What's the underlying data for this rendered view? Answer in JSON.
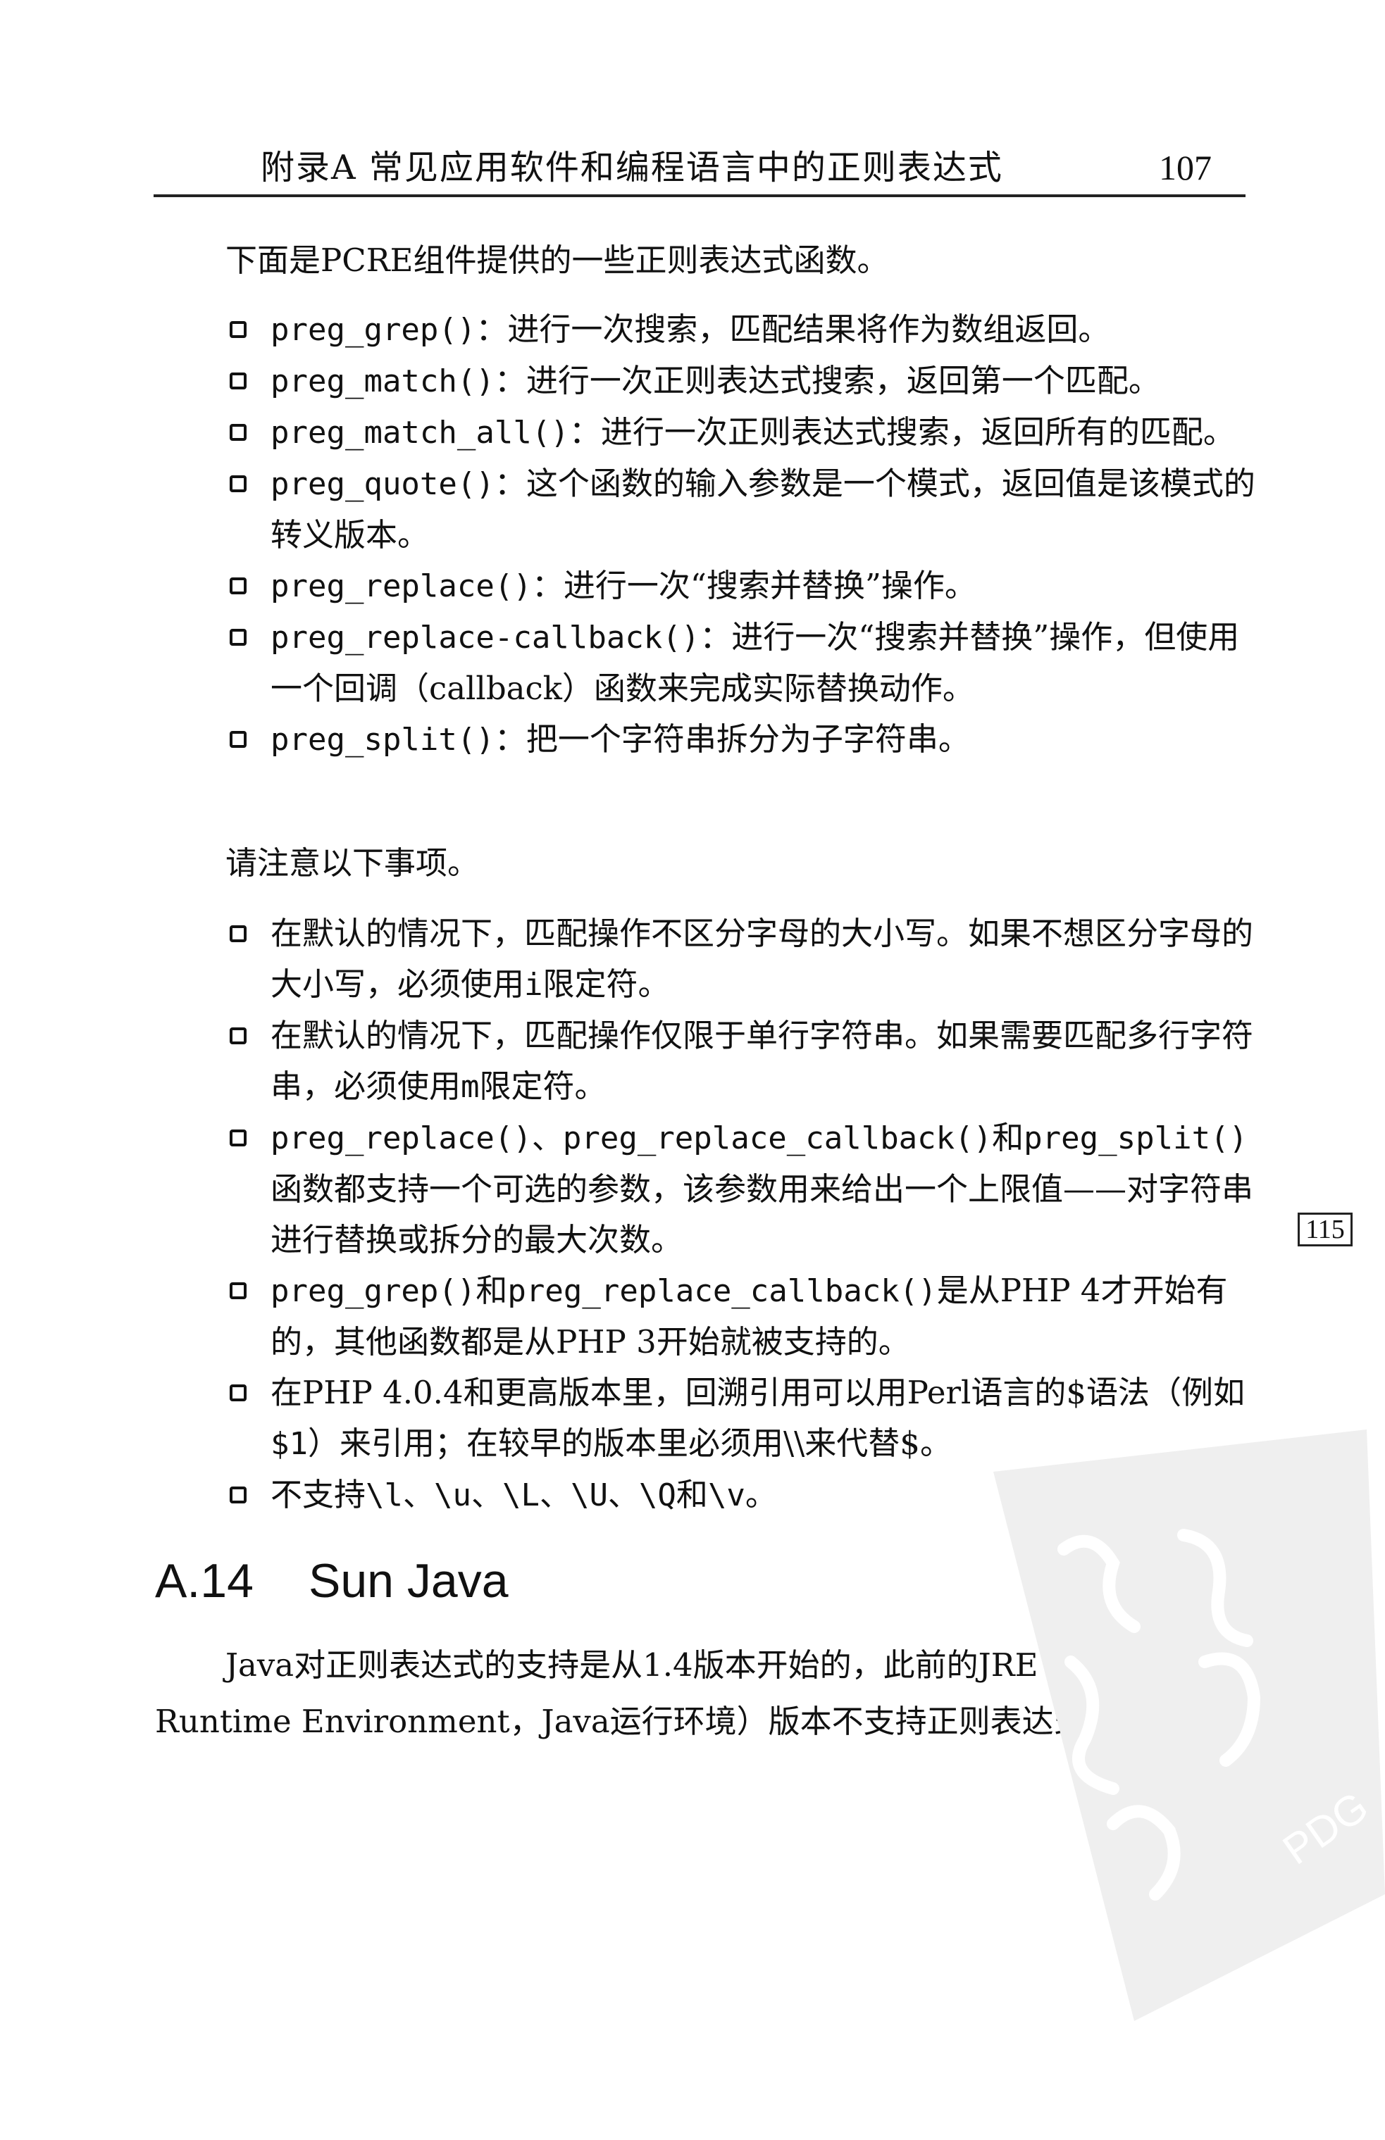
{
  "header": {
    "chapter": "附录A  常见应用软件和编程语言中的正则表达式",
    "page_number": "107"
  },
  "intro": "下面是PCRE组件提供的一些正则表达式函数。",
  "functions": [
    {
      "code": "preg_grep()",
      "sep": "：",
      "desc": "进行一次搜索，匹配结果将作为数组返回。"
    },
    {
      "code": "preg_match()",
      "sep": "：",
      "desc": "进行一次正则表达式搜索，返回第一个匹配。"
    },
    {
      "code": "preg_match_all()",
      "sep": "：",
      "desc": "进行一次正则表达式搜索，返回所有的匹配。"
    },
    {
      "code": "preg_quote()",
      "sep": "：",
      "desc": "这个函数的输入参数是一个模式，返回值是该模式的转义版本。"
    },
    {
      "code": "preg_replace()",
      "sep": "：",
      "desc": "进行一次“搜索并替换”操作。"
    },
    {
      "code": "preg_replace-callback()",
      "sep": "：",
      "desc": "进行一次“搜索并替换”操作，但使用一个回调（callback）函数来完成实际替换动作。"
    },
    {
      "code": "preg_split()",
      "sep": "：",
      "desc": "把一个字符串拆分为子字符串。"
    }
  ],
  "notes_intro": "请注意以下事项。",
  "notes": [
    {
      "pre": "在默认的情况下，匹配操作不区分字母的大小写。如果不想区分字母的大小写，必须使用",
      "code": "i",
      "post": "限定符。"
    },
    {
      "pre": "在默认的情况下，匹配操作仅限于单行字符串。如果需要匹配多行字符串，必须使用",
      "code": "m",
      "post": "限定符。"
    },
    {
      "pre": "",
      "code": "preg_replace()、preg_replace_callback()",
      "mid": "和",
      "code2": "preg_split()",
      "post": "函数都支持一个可选的参数，该参数用来给出一个上限值——对字符串进行替换或拆分的最大次数。"
    },
    {
      "pre": "",
      "code": "preg_grep()",
      "mid": "和",
      "code2": "preg_replace_callback()",
      "post": "是从PHP 4才开始有的，其他函数都是从PHP 3开始就被支持的。"
    },
    {
      "pre": "在PHP 4.0.4和更高版本里，回溯引用可以用Perl语言的$语法（例如",
      "code": "$1",
      "post": "）来引用；在较早的版本里必须用\\\\来代替$。"
    },
    {
      "pre": "不支持",
      "code": "\\l、\\u、\\L、\\U、\\Q",
      "mid": "和",
      "code2": "\\v",
      "post": "。"
    }
  ],
  "margin_note": "115",
  "section": {
    "number": "A.14",
    "title": "Sun Java"
  },
  "java_para": {
    "line1": "Java对正则表达式的支持是从1.4版本开始的，此前的JRE（Java",
    "line2": "Runtime Environment，Java运行环境）版本不支持正则表达式。"
  },
  "watermark": {
    "text": "PDG",
    "color": "#d4d4d4"
  }
}
